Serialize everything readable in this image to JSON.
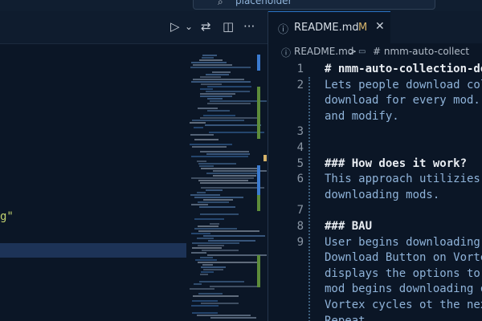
{
  "titlebar": {
    "search_placeholder": "placeholder",
    "search_icon": "search-icon"
  },
  "left_actions": [
    {
      "icon": "run-icon",
      "glyph": "▷"
    },
    {
      "icon": "chevron-down-icon",
      "glyph": "⌄"
    },
    {
      "icon": "compare-changes-icon",
      "glyph": "⇄"
    },
    {
      "icon": "split-editor-icon",
      "glyph": "◫"
    },
    {
      "icon": "more-actions-icon",
      "glyph": "···"
    }
  ],
  "left_editor": {
    "code_fragment": "g\""
  },
  "right": {
    "tab": {
      "label": "README.md",
      "modified_marker": "M",
      "close_glyph": "✕",
      "info_icon": "info-icon"
    },
    "breadcrumb": {
      "file": "README.md",
      "separator": ">",
      "symbol": "# nmm-auto-collect"
    },
    "lines": [
      {
        "n": "1",
        "text": "# nmm-auto-collection-do",
        "header": true
      },
      {
        "n": "2",
        "text": "Lets people download col",
        "header": false
      },
      {
        "n": "",
        "text": "download for every mod.",
        "header": false
      },
      {
        "n": "",
        "text": "and modify.",
        "header": false
      },
      {
        "n": "3",
        "text": "",
        "header": false
      },
      {
        "n": "4",
        "text": "",
        "header": false
      },
      {
        "n": "5",
        "text": "### How does it work?",
        "header": true
      },
      {
        "n": "6",
        "text": "This approach utilizies",
        "header": false
      },
      {
        "n": "",
        "text": "downloading mods.",
        "header": false
      },
      {
        "n": "7",
        "text": "",
        "header": false
      },
      {
        "n": "8",
        "text": "### BAU",
        "header": true
      },
      {
        "n": "9",
        "text": "User begins downloading",
        "header": false
      },
      {
        "n": "",
        "text": "Download Button on Vorte",
        "header": false
      },
      {
        "n": "",
        "text": "displays the options to",
        "header": false
      },
      {
        "n": "",
        "text": "mod begins downloading o",
        "header": false
      },
      {
        "n": "",
        "text": "Vortex cycles ot the nex",
        "header": false
      },
      {
        "n": "",
        "text": "Repeat.",
        "header": false
      }
    ]
  }
}
